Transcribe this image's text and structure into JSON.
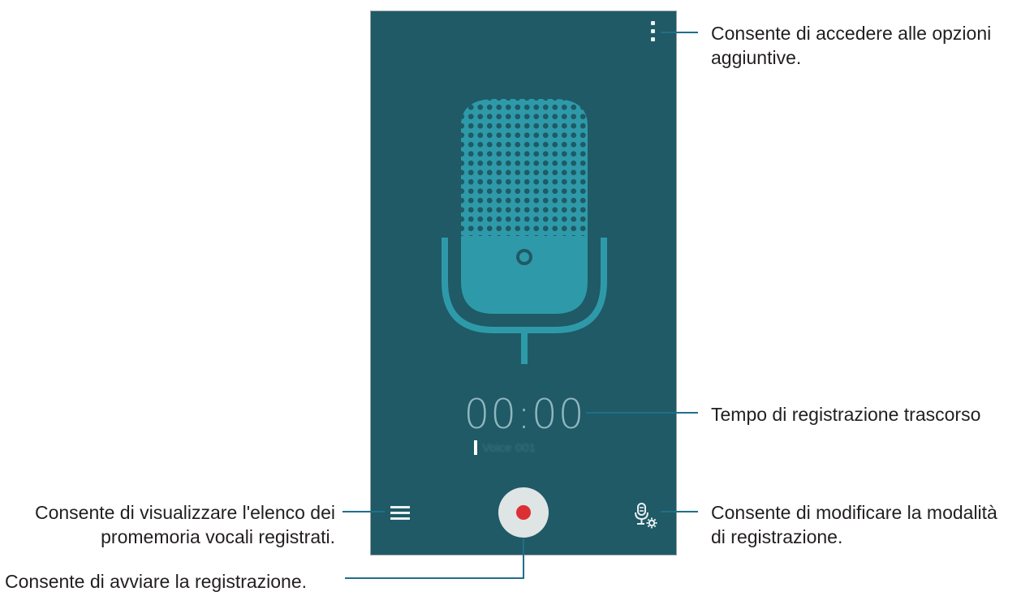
{
  "colors": {
    "screen_bg": "#1f5a66",
    "mic_fill": "#2e9aa9",
    "record_dot": "#dd2f33",
    "record_button_bg": "#dfe4e5",
    "callout_line": "#1f6f8a"
  },
  "icons": {
    "more_options": "vertical-dots-icon",
    "list": "list-icon",
    "record": "record-icon",
    "mode": "mic-settings-icon",
    "microphone": "microphone-illustration"
  },
  "screen": {
    "timer": "00:00",
    "file_name": "Voice 001"
  },
  "callouts": {
    "options": [
      "Consente di accedere alle opzioni",
      "aggiuntive."
    ],
    "elapsed_time": [
      "Tempo di registrazione trascorso"
    ],
    "mode": [
      "Consente di modificare la modalità",
      "di registrazione."
    ],
    "list": [
      "Consente di visualizzare l'elenco dei",
      "promemoria vocali registrati."
    ],
    "record": [
      "Consente di avviare la registrazione."
    ]
  }
}
